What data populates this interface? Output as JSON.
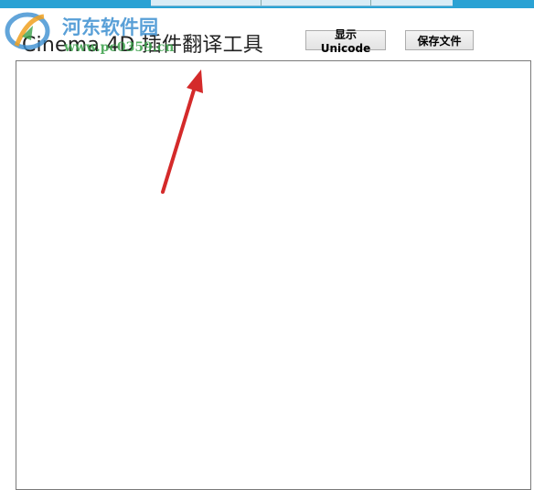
{
  "window": {
    "title": "Cinema 4D 插件翻译工具"
  },
  "toolbar": {
    "show_unicode_label": "显示Unicode",
    "save_file_label": "保存文件"
  },
  "editor": {
    "value": ""
  },
  "watermark": {
    "site_name": "河东软件园",
    "url": "www.pc0359.cn"
  },
  "colors": {
    "top_bar": "#2aa2d4",
    "watermark_blue": "#3b8fd1",
    "watermark_green": "#3aa04a",
    "arrow_red": "#d42a2a"
  }
}
